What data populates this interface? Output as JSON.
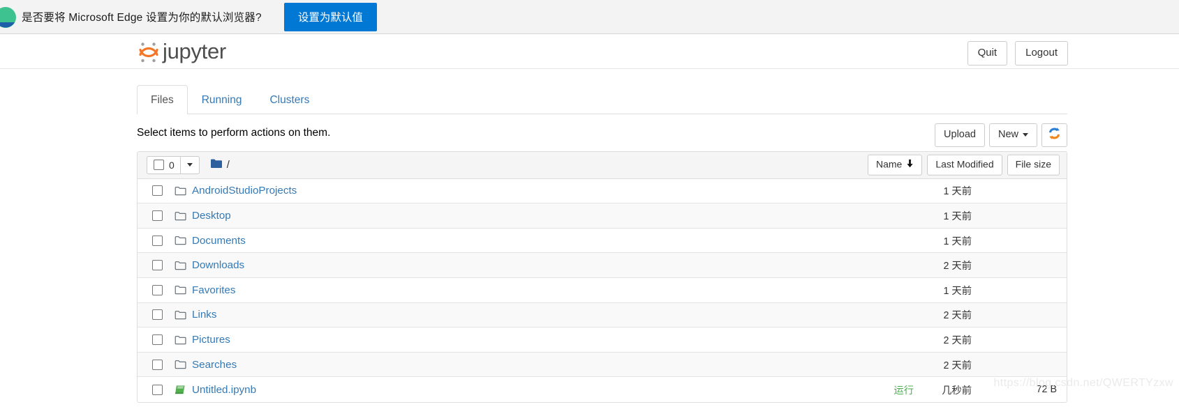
{
  "browser_bar": {
    "message": "是否要将 Microsoft Edge 设置为你的默认浏览器?",
    "set_default_label": "设置为默认值",
    "accent_color": "#0078d4",
    "logo_icon": "edge-logo-icon"
  },
  "header": {
    "logo_text": "jupyter",
    "logo_icon": "jupyter-logo-icon",
    "quit_label": "Quit",
    "logout_label": "Logout"
  },
  "tabs": [
    {
      "label": "Files",
      "active": true
    },
    {
      "label": "Running",
      "active": false
    },
    {
      "label": "Clusters",
      "active": false
    }
  ],
  "toolbar": {
    "select_message": "Select items to perform actions on them.",
    "upload_label": "Upload",
    "new_label": "New",
    "new_caret_icon": "chevron-down-icon",
    "refresh_icon": "refresh-icon"
  },
  "list_header": {
    "selected_count": "0",
    "select_all_checkbox_icon": "checkbox-icon",
    "dropdown_caret_icon": "chevron-down-icon",
    "folder_icon": "folder-filled-icon",
    "breadcrumb_path": "/",
    "sort_name_label": "Name",
    "sort_name_direction_icon": "arrow-down-icon",
    "sort_modified_label": "Last Modified",
    "sort_size_label": "File size"
  },
  "files": [
    {
      "name": "AndroidStudioProjects",
      "icon": "folder-icon",
      "type": "folder",
      "modified": "1 天前",
      "size": "",
      "running": ""
    },
    {
      "name": "Desktop",
      "icon": "folder-icon",
      "type": "folder",
      "modified": "1 天前",
      "size": "",
      "running": ""
    },
    {
      "name": "Documents",
      "icon": "folder-icon",
      "type": "folder",
      "modified": "1 天前",
      "size": "",
      "running": ""
    },
    {
      "name": "Downloads",
      "icon": "folder-icon",
      "type": "folder",
      "modified": "2 天前",
      "size": "",
      "running": ""
    },
    {
      "name": "Favorites",
      "icon": "folder-icon",
      "type": "folder",
      "modified": "1 天前",
      "size": "",
      "running": ""
    },
    {
      "name": "Links",
      "icon": "folder-icon",
      "type": "folder",
      "modified": "2 天前",
      "size": "",
      "running": ""
    },
    {
      "name": "Pictures",
      "icon": "folder-icon",
      "type": "folder",
      "modified": "2 天前",
      "size": "",
      "running": ""
    },
    {
      "name": "Searches",
      "icon": "folder-icon",
      "type": "folder",
      "modified": "2 天前",
      "size": "",
      "running": ""
    },
    {
      "name": "Untitled.ipynb",
      "icon": "notebook-icon",
      "type": "notebook",
      "modified": "几秒前",
      "size": "72 B",
      "running": "运行"
    }
  ],
  "watermark": "https://blog.csdn.net/QWERTYzxw"
}
